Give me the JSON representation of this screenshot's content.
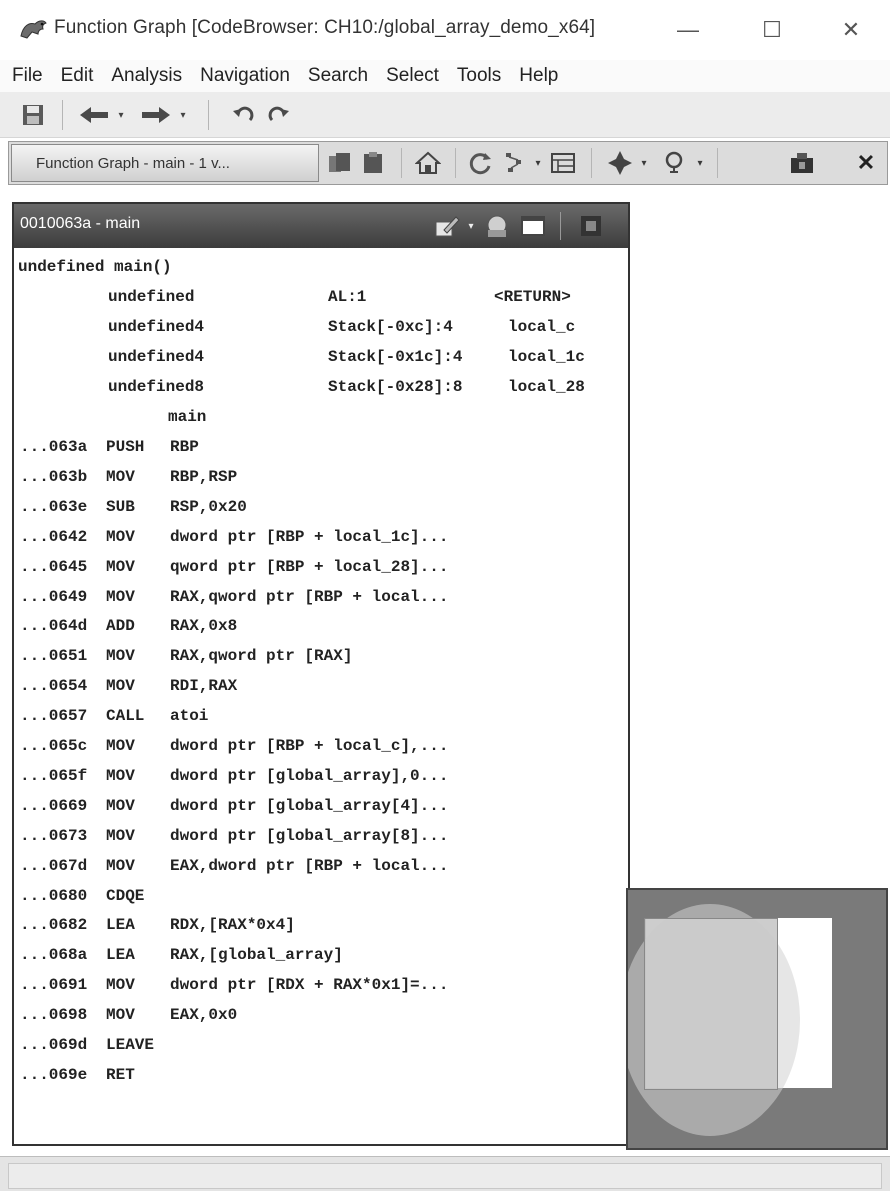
{
  "window": {
    "title": "Function Graph [CodeBrowser: CH10:/global_array_demo_x64]",
    "minimize_glyph": "—",
    "maximize_glyph": "☐",
    "close_glyph": "✕"
  },
  "menu": [
    "File",
    "Edit",
    "Analysis",
    "Navigation",
    "Search",
    "Select",
    "Tools",
    "Help"
  ],
  "toolbar": {
    "icons": [
      "save-icon",
      "back-arrow-icon",
      "back-dropdown-icon",
      "forward-arrow-icon",
      "forward-dropdown-icon",
      "undo-icon",
      "redo-icon"
    ]
  },
  "graph_toolbar": {
    "tab_label": "Function Graph - main - 1 v...",
    "icons": [
      "copy-icon",
      "paste-icon",
      "home-icon",
      "refresh-icon",
      "layout-icon",
      "layout-dropdown-icon",
      "format-icon",
      "navigate-icon",
      "navigate-dropdown-icon",
      "zoom-icon",
      "zoom-dropdown-icon",
      "snapshot-icon",
      "close-icon"
    ],
    "close_glyph": "✕"
  },
  "function_block": {
    "title": "0010063a - main",
    "signature": "undefined main()",
    "variables": [
      {
        "type": "undefined",
        "storage": "AL:1",
        "name": "<RETURN>"
      },
      {
        "type": "undefined4",
        "storage": "Stack[-0xc]:4",
        "name": "local_c"
      },
      {
        "type": "undefined4",
        "storage": "Stack[-0x1c]:4",
        "name": "local_1c"
      },
      {
        "type": "undefined8",
        "storage": "Stack[-0x28]:8",
        "name": "local_28"
      }
    ],
    "label": "main",
    "instructions": [
      {
        "addr": "...063a",
        "mnemonic": "PUSH",
        "operands": "RBP"
      },
      {
        "addr": "...063b",
        "mnemonic": "MOV",
        "operands": "RBP,RSP"
      },
      {
        "addr": "...063e",
        "mnemonic": "SUB",
        "operands": "RSP,0x20"
      },
      {
        "addr": "...0642",
        "mnemonic": "MOV",
        "operands": "dword ptr [RBP + local_1c]..."
      },
      {
        "addr": "...0645",
        "mnemonic": "MOV",
        "operands": "qword ptr [RBP + local_28]..."
      },
      {
        "addr": "...0649",
        "mnemonic": "MOV",
        "operands": "RAX,qword ptr [RBP + local..."
      },
      {
        "addr": "...064d",
        "mnemonic": "ADD",
        "operands": "RAX,0x8"
      },
      {
        "addr": "...0651",
        "mnemonic": "MOV",
        "operands": "RAX,qword ptr [RAX]"
      },
      {
        "addr": "...0654",
        "mnemonic": "MOV",
        "operands": "RDI,RAX"
      },
      {
        "addr": "...0657",
        "mnemonic": "CALL",
        "operands": "atoi"
      },
      {
        "addr": "...065c",
        "mnemonic": "MOV",
        "operands": "dword ptr [RBP + local_c],..."
      },
      {
        "addr": "...065f",
        "mnemonic": "MOV",
        "operands": "dword ptr [global_array],0..."
      },
      {
        "addr": "...0669",
        "mnemonic": "MOV",
        "operands": "dword ptr [global_array[4]..."
      },
      {
        "addr": "...0673",
        "mnemonic": "MOV",
        "operands": "dword ptr [global_array[8]..."
      },
      {
        "addr": "...067d",
        "mnemonic": "MOV",
        "operands": "EAX,dword ptr [RBP + local..."
      },
      {
        "addr": "...0680",
        "mnemonic": "CDQE",
        "operands": ""
      },
      {
        "addr": "...0682",
        "mnemonic": "LEA",
        "operands": "RDX,[RAX*0x4]"
      },
      {
        "addr": "...068a",
        "mnemonic": "LEA",
        "operands": "RAX,[global_array]"
      },
      {
        "addr": "...0691",
        "mnemonic": "MOV",
        "operands": "dword ptr [RDX + RAX*0x1]=..."
      },
      {
        "addr": "...0698",
        "mnemonic": "MOV",
        "operands": "EAX,0x0"
      },
      {
        "addr": "...069d",
        "mnemonic": "LEAVE",
        "operands": ""
      },
      {
        "addr": "...069e",
        "mnemonic": "RET",
        "operands": ""
      }
    ]
  }
}
